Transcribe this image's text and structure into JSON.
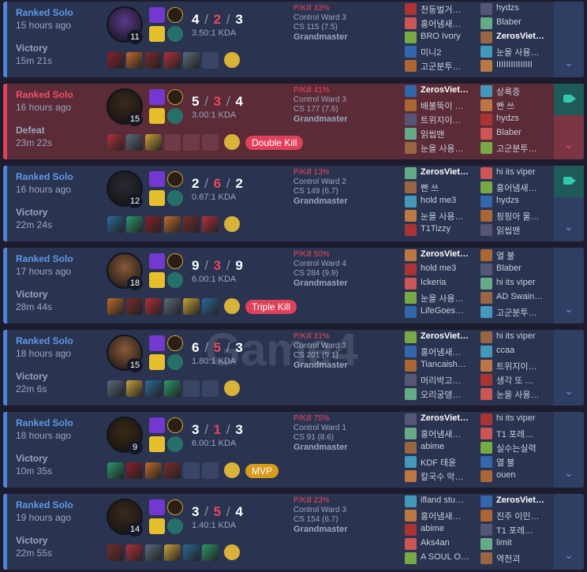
{
  "watermark": "Game4",
  "matches": [
    {
      "queue": "Ranked Solo",
      "ago": "15 hours ago",
      "result": "Victory",
      "duration": "15m 21s",
      "level": "11",
      "k": "4",
      "d": "2",
      "a": "3",
      "kda": "3.50:1 KDA",
      "pkill": "P/Kill 33%",
      "ward": "Control Ward 3",
      "cs": "CS 115 (7.5)",
      "tier": "Grandmaster",
      "badge": "",
      "video": false,
      "team1": [
        "천둥벌거…",
        "홍어냄새…",
        "BRO Ivory",
        "미니2",
        "고군분투…"
      ],
      "team2": [
        "hydzs",
        "Blaber",
        "ZerosViet…",
        "눈을 사용…",
        "IIIIIIIIIIIIIII"
      ],
      "me": "ZerosViet…",
      "empty": 1
    },
    {
      "queue": "Ranked Solo",
      "ago": "16 hours ago",
      "result": "Defeat",
      "duration": "23m 22s",
      "level": "15",
      "k": "5",
      "d": "3",
      "a": "4",
      "kda": "3.00:1 KDA",
      "pkill": "P/Kill 41%",
      "ward": "Control Ward 3",
      "cs": "CS 177 (7.6)",
      "tier": "Grandmaster",
      "badge": "Double Kill",
      "video": true,
      "team1": [
        "ZerosViet…",
        "배불뚝이 …",
        "트위지이…",
        "읽씹맨",
        "눈을 사용…"
      ],
      "team2": [
        "상록증",
        "빤 쓰",
        "hydzs",
        "Blaber",
        "고군분투…"
      ],
      "me": "ZerosViet…",
      "empty": 3
    },
    {
      "queue": "Ranked Solo",
      "ago": "16 hours ago",
      "result": "Victory",
      "duration": "22m 24s",
      "level": "12",
      "k": "2",
      "d": "6",
      "a": "2",
      "kda": "0.67:1 KDA",
      "pkill": "P/Kill 13%",
      "ward": "Control Ward 2",
      "cs": "CS 149 (6.7)",
      "tier": "Grandmaster",
      "badge": "",
      "video": true,
      "team1": [
        "ZerosViet…",
        "빤 쓰",
        "hold me3",
        "눈을 사용…",
        "T1Tizzy"
      ],
      "team2": [
        "hi its viper",
        "홍어냄새…",
        "hydzs",
        "핑핑아 울…",
        "읽씹맨"
      ],
      "me": "ZerosViet…",
      "empty": 0
    },
    {
      "queue": "Ranked Solo",
      "ago": "17 hours ago",
      "result": "Victory",
      "duration": "28m 44s",
      "level": "18",
      "k": "9",
      "d": "3",
      "a": "9",
      "kda": "6.00:1 KDA",
      "pkill": "P/Kill 50%",
      "ward": "Control Ward 4",
      "cs": "CS 284 (9.9)",
      "tier": "Grandmaster",
      "badge": "Triple Kill",
      "video": false,
      "team1": [
        "ZerosViet…",
        "hold me3",
        "Ickeria",
        "눈을 사용…",
        "LifeGoes…"
      ],
      "team2": [
        "열 불",
        "Blaber",
        "hi its viper",
        "AD Swain…",
        "고군분투…"
      ],
      "me": "ZerosViet…",
      "empty": 0
    },
    {
      "queue": "Ranked Solo",
      "ago": "18 hours ago",
      "result": "Victory",
      "duration": "22m 6s",
      "level": "15",
      "k": "6",
      "d": "5",
      "a": "3",
      "kda": "1.80:1 KDA",
      "pkill": "P/Kill 31%",
      "ward": "Control Ward 3",
      "cs": "CS 201 (9.1)",
      "tier": "Grandmaster",
      "badge": "",
      "video": false,
      "team1": [
        "ZerosViet…",
        "홍어냄새…",
        "Tiancaish…",
        "머리박고…",
        "오리궁뎅…"
      ],
      "team2": [
        "hi its viper",
        "ccaa",
        "트위지이…",
        "생각 또 …",
        "눈을 사용…"
      ],
      "me": "ZerosViet…",
      "empty": 2
    },
    {
      "queue": "Ranked Solo",
      "ago": "18 hours ago",
      "result": "Victory",
      "duration": "10m 35s",
      "level": "9",
      "k": "3",
      "d": "1",
      "a": "3",
      "kda": "6.00:1 KDA",
      "pkill": "P/Kill 75%",
      "ward": "Control Ward 1",
      "cs": "CS 91 (8.6)",
      "tier": "Grandmaster",
      "badge": "MVP",
      "video": false,
      "team1": [
        "ZerosViet…",
        "홍어냄새…",
        "abime",
        "KDF 태윤",
        "칼국수 막…"
      ],
      "team2": [
        "hi its viper",
        "T1 포레…",
        "실수는실력",
        "열 불",
        "ouen"
      ],
      "me": "ZerosViet…",
      "empty": 2
    },
    {
      "queue": "Ranked Solo",
      "ago": "19 hours ago",
      "result": "Victory",
      "duration": "22m 55s",
      "level": "14",
      "k": "3",
      "d": "5",
      "a": "4",
      "kda": "1.40:1 KDA",
      "pkill": "P/Kill 23%",
      "ward": "Control Ward 3",
      "cs": "CS 154 (6.7)",
      "tier": "Grandmaster",
      "badge": "",
      "video": false,
      "team1": [
        "ifland stu…",
        "홍어냄새…",
        "abime",
        "Aks4an",
        "A SOUL O…"
      ],
      "team2": [
        "ZerosViet…",
        "진주 이민…",
        "T1 포레…",
        "limit",
        "역천괴"
      ],
      "me": "ZerosViet…",
      "empty": 0
    }
  ],
  "colors": {
    "victory": "#4d84d8",
    "defeat": "#e0415a",
    "kill_badge": "#e0415a",
    "mvp_badge": "#d89a1a"
  },
  "icons": {
    "expand": "chevron-down-icon",
    "video": "video-camera-icon",
    "ward": "trinket-ward-icon"
  }
}
